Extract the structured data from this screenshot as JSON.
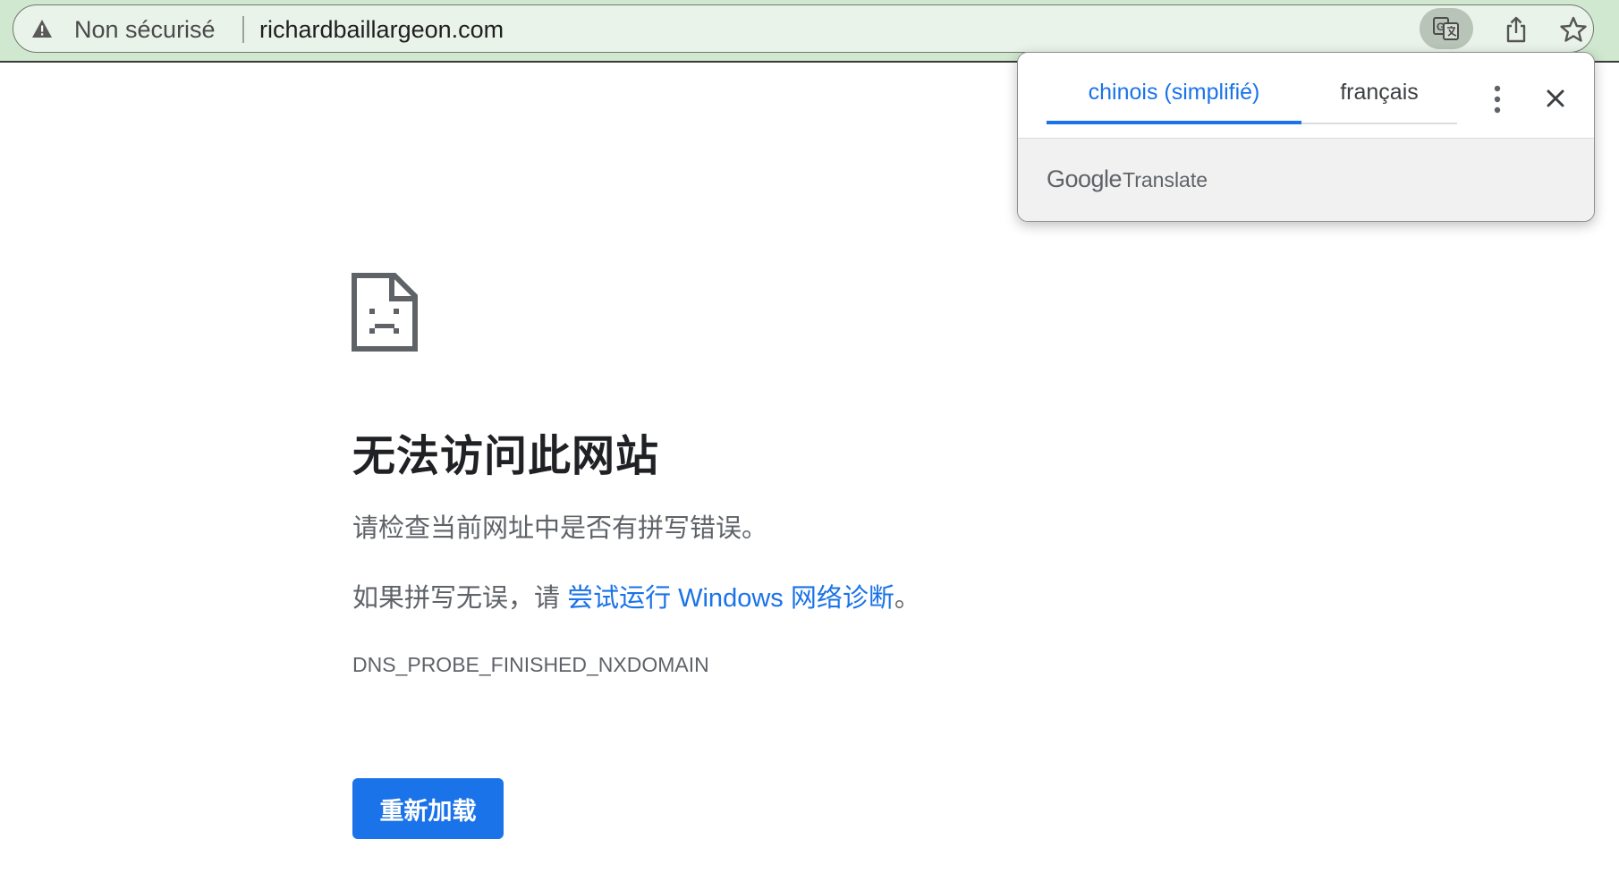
{
  "omnibox": {
    "security_label": "Non sécurisé",
    "url": "richardbaillargeon.com",
    "icons": {
      "security": "warning-triangle-icon",
      "translate": "translate-icon",
      "share": "share-icon",
      "bookmark": "star-icon"
    }
  },
  "translate_bubble": {
    "source_tab": "chinois (simplifié)",
    "target_tab": "français",
    "brand_logo": "Google",
    "brand_product": "Translate",
    "icons": {
      "more": "more-vert-icon",
      "close": "close-icon"
    }
  },
  "error_page": {
    "icon": "sad-document-icon",
    "title": "无法访问此网站",
    "suggestion_1": "请检查当前网址中是否有拼写错误。",
    "suggestion_2_prefix": "如果拼写无误，请 ",
    "suggestion_2_link": "尝试运行 Windows 网络诊断",
    "suggestion_2_suffix": "。",
    "error_code": "DNS_PROBE_FINISHED_NXDOMAIN",
    "reload_button": "重新加载"
  },
  "colors": {
    "toolbar_bg": "#cfe8cf",
    "accent_blue": "#1a73e8",
    "text_dark": "#202124",
    "text_muted": "#5f6368"
  }
}
